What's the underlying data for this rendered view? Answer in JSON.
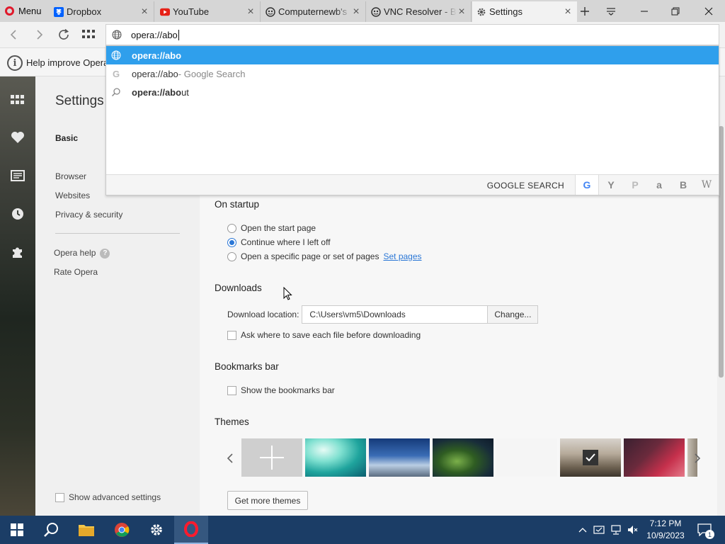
{
  "browser": {
    "menu_label": "Menu",
    "tabs": [
      {
        "label": "Dropbox",
        "icon": "dropbox-icon"
      },
      {
        "label": "YouTube",
        "icon": "youtube-icon"
      },
      {
        "label": "Computernewb's",
        "icon": "computernewb-icon"
      },
      {
        "label": "VNC Resolver - Br",
        "icon": "vnc-resolver-icon"
      },
      {
        "label": "Settings",
        "icon": "gear-icon",
        "active": true
      }
    ],
    "colors": {
      "accent": "#2f9fec",
      "opera_red": "#e0192b",
      "link": "#2b77d6",
      "taskbar": "#1b3d66"
    }
  },
  "omnibox": {
    "value": "opera://abo",
    "suggestions": [
      {
        "bold": "opera://abo",
        "rest": "",
        "suffix": "",
        "icon": "globe-icon",
        "selected": true
      },
      {
        "bold": "",
        "rest": "opera://abo",
        "suffix": " - Google Search",
        "icon": "google-icon",
        "selected": false
      },
      {
        "bold": "opera://abo",
        "rest": "ut",
        "suffix": "",
        "icon": "search-icon",
        "selected": false
      }
    ],
    "search_engines_label": "GOOGLE SEARCH",
    "search_engines": [
      "G",
      "Y",
      "P",
      "a",
      "B",
      "W"
    ]
  },
  "infobar": {
    "text": "Help improve Opera"
  },
  "settings_nav": {
    "title": "Settings",
    "basic": "Basic",
    "items": [
      "Browser",
      "Websites",
      "Privacy & security"
    ],
    "help": "Opera help",
    "help_badge": "?",
    "rate": "Rate Opera",
    "advanced": "Show advanced settings"
  },
  "main": {
    "startup": {
      "title": "On startup",
      "options": [
        "Open the start page",
        "Continue where I left off",
        "Open a specific page or set of pages"
      ],
      "selected_index": 1,
      "set_pages_link": "Set pages"
    },
    "downloads": {
      "title": "Downloads",
      "location_label": "Download location:",
      "location_value": "C:\\Users\\vm5\\Downloads",
      "change_button": "Change...",
      "ask_label": "Ask where to save each file before downloading"
    },
    "bookmarks": {
      "title": "Bookmarks bar",
      "show_label": "Show the bookmarks bar"
    },
    "themes": {
      "title": "Themes",
      "get_more": "Get more themes"
    }
  },
  "taskbar": {
    "time": "7:12 PM",
    "date": "10/9/2023",
    "notification_count": "1"
  }
}
